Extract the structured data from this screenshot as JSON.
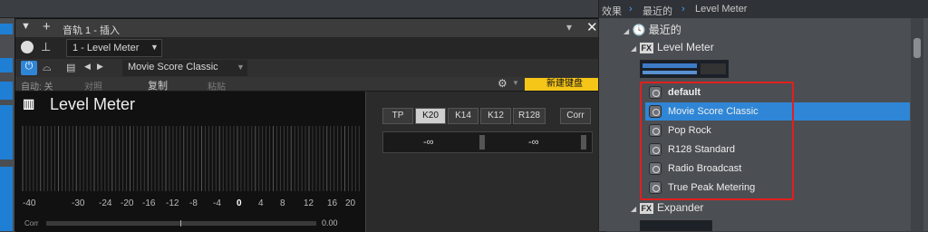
{
  "plugin": {
    "track_title": "音轨 1 - 插入",
    "insert_name": "1 - Level Meter",
    "preset_name": "Movie Score Classic",
    "auto_label": "自动: 关",
    "compare_label": "对照",
    "copy_label": "复制",
    "paste_label": "粘贴",
    "new_keyboard_label": "新建键盘",
    "brand_title": "Level Meter",
    "buttons": [
      "TP",
      "K20",
      "K14",
      "K12",
      "R128"
    ],
    "active_button": "K20",
    "corr_button": "Corr",
    "readout_left": "-∞",
    "readout_right": "-∞",
    "scale": [
      "-40",
      "-30",
      "-24",
      "-20",
      "-16",
      "-12",
      "-8",
      "-4",
      "0",
      "4",
      "8",
      "12",
      "16",
      "20"
    ],
    "corr_label": "Corr",
    "corr_value": "0.00"
  },
  "browser": {
    "breadcrumb": [
      "效果",
      "最近的",
      "Level Meter"
    ],
    "recent": "最近的",
    "level_meter": "Level Meter",
    "expander": "Expander",
    "presets": [
      "default",
      "Movie Score Classic",
      "Pop Rock",
      "R128 Standard",
      "Radio Broadcast",
      "True Peak Metering"
    ],
    "selected_preset": "Movie Score Classic"
  },
  "colors": {
    "selection": "#2f86d6",
    "highlight_box": "#e0201d",
    "new_keyboard_bg": "#f5c518"
  }
}
